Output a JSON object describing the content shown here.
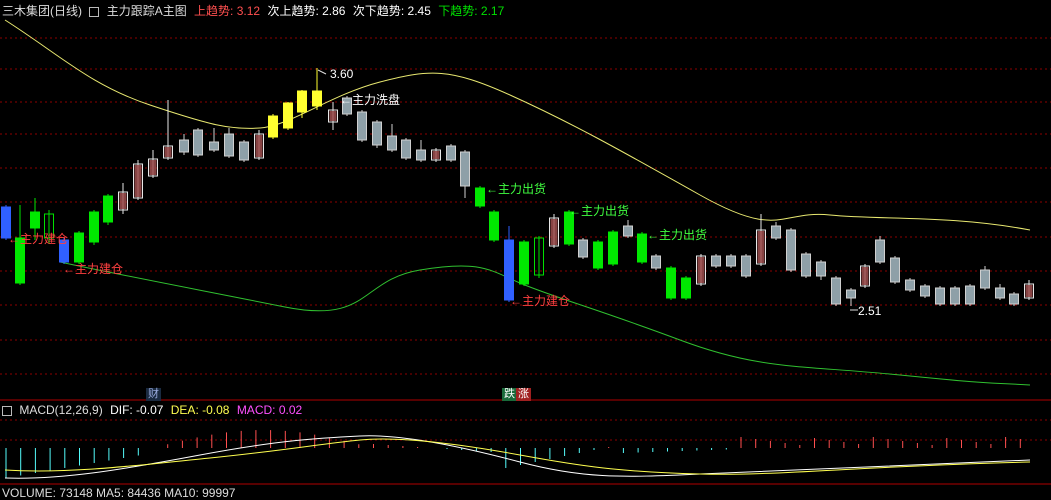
{
  "header": {
    "stock_name": "三木集团(日线)",
    "indicator_name": "主力跟踪A主图",
    "up_trend_label": "上趋势:",
    "up_trend_value": "3.12",
    "sub_up_label": "次上趋势:",
    "sub_up_value": "2.86",
    "sub_down_label": "次下趋势:",
    "sub_down_value": "2.45",
    "down_trend_label": "下趋势:",
    "down_trend_value": "2.17"
  },
  "annotations": {
    "high_label": "3.60",
    "low_label": "2.51",
    "wash_label": "主力洗盘",
    "build_label_1": "←主力建仓",
    "build_label_2": "←主力建仓",
    "build_label_3": "←主力建仓",
    "ship_label_1": "主力出货",
    "ship_label_2": "主力出货",
    "ship_label_3": "主力出货"
  },
  "markers": {
    "finance": "财",
    "fall": "跌",
    "rise": "涨"
  },
  "macd": {
    "title": "MACD(12,26,9)",
    "dif_label": "DIF: -0.07",
    "dea_label": "DEA: -0.08",
    "macd_label": "MACD: 0.02"
  },
  "volume": {
    "label": "VOLUME: 73148  MA5: 84436  MA10: 99997"
  },
  "colors": {
    "up": "#ff5050",
    "down": "#54fcfc",
    "yellow": "#ffff50",
    "green": "#00e000",
    "grid": "#8b0000"
  },
  "chart_data": {
    "type": "candlestick",
    "high": 3.6,
    "low": 2.51
  }
}
